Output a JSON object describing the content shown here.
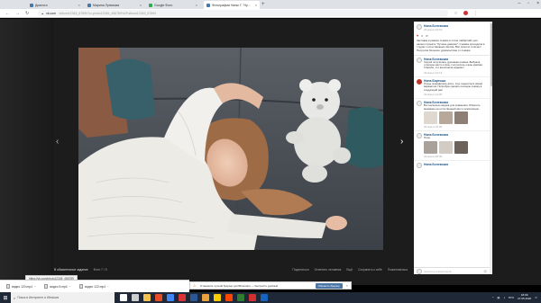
{
  "tabs": [
    {
      "title": "Диалоги",
      "color": "#4a76a8",
      "active": false
    },
    {
      "title": "Марина Лунихова",
      "color": "#4a76a8",
      "active": false
    },
    {
      "title": "Google Фото",
      "color": "#34a853",
      "active": false
    },
    {
      "title": "Google Фото",
      "color": "#fbbc04",
      "active": false
    },
    {
      "title": "Фотографии Нины Г. \"Нужна...\"",
      "color": "#4a76a8",
      "active": true
    }
  ],
  "url": {
    "host": "vk.com",
    "path": "/album12345_67890?z=photo12345_456789%2Falbum12345_67890"
  },
  "photo_nav": {
    "prev": "‹",
    "next": "›"
  },
  "photo_footer": {
    "album_label": "В обязательное задание",
    "counter": "Фото 7 / 9",
    "actions": [
      "Поделиться",
      "Отметить человека",
      "Ещё",
      "Сохранить к себе",
      "Пожаловаться"
    ]
  },
  "post": {
    "author": "Нина Белевская",
    "time": "22 мая в 13:10",
    "like_count": "6",
    "caption": "Заставка в рамках съёмки в стиле лайфстайл для нашего проекта \"Лучшие девочки\". Съёмка проходила в студии с естественным светом. Всё прошло отлично! Получила большое удовольствие от съёмки."
  },
  "comments": [
    {
      "author": "Нина Белевская",
      "time": "22 мая в 13:14",
      "text": "Сергей получилась душевная съёмка. Выбрала отличное место и фон, получилось очень красиво. Спасибо, что выполнила задание!",
      "avatar_red": false,
      "thumbs": []
    },
    {
      "author": "Нина Бартоши",
      "time": "22 мая в 14:20",
      "text": "Очень понравились фото, хочу поделиться своим вариантом. Попробую сделать похожую съёмку в следующий раз!",
      "avatar_red": true,
      "thumbs": []
    },
    {
      "author": "Нина Белевская",
      "time": "22 мая в 15:02",
      "text": "Вот несколько кадров для сравнения. Обратите внимание на естественный свет и композицию.",
      "avatar_red": false,
      "thumbs": [
        "#ded8d1",
        "#b7a89a",
        "#8d7f75"
      ]
    },
    {
      "author": "Нина Белевская",
      "time": "22 мая в 15:30",
      "text": "Позы",
      "avatar_red": false,
      "thumbs": [
        "#a9a29b",
        "#d3ccc4",
        "#6b625c"
      ]
    },
    {
      "author": "Нина Белевская",
      "time": "",
      "text": "",
      "avatar_red": false,
      "thumbs": []
    }
  ],
  "comment_input_placeholder": "Написать комментарий...",
  "status_url": "https://vk.com/photo12345_456789",
  "notification": {
    "message": "Установите лучший браузер для ВКонтакте — быстрый и удобный",
    "button": "Обновить браузер",
    "close": "×"
  },
  "downloads": [
    {
      "name": "видео 120.mp4"
    },
    {
      "name": "видео 5.mp4"
    },
    {
      "name": "видео 122.mp4"
    }
  ],
  "taskbar": {
    "search_placeholder": "Поиск в Интернете и Windows",
    "app_colors": [
      "#ffffff",
      "#cfcfcf",
      "#f2c14e",
      "#e44d26",
      "#4285f4",
      "#db3236",
      "#2b5797",
      "#e8a33d",
      "#ffcc00",
      "#ff4500",
      "#2e7d32",
      "#d32f2f",
      "#1565c0"
    ],
    "time": "18:09",
    "date": "27.05.2020",
    "lang": "РУС"
  }
}
